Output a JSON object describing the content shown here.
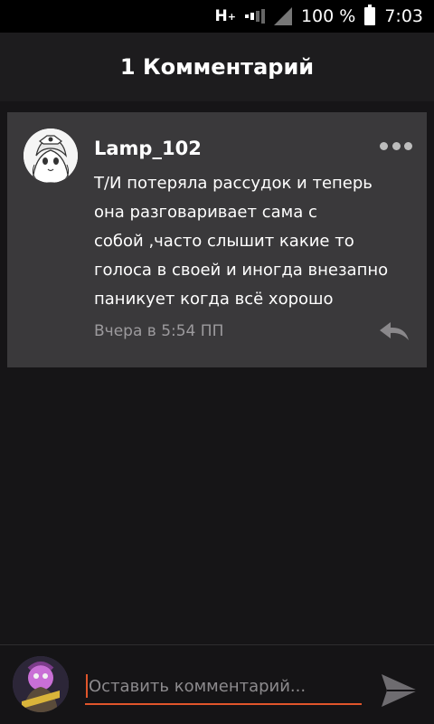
{
  "status_bar": {
    "network_type": "H",
    "network_sup": "+",
    "battery_percent": "100 %",
    "time": "7:03"
  },
  "header": {
    "title": "1 Комментарий"
  },
  "comment": {
    "username": "Lamp_102",
    "text": "Т/И потеряла рассудок и теперь\nона разговаривает сама с\nсобой ,часто  слышит какие то\nголоса в своей и иногда внезапно\nпаникует когда всё хорошо",
    "timestamp": "Вчера в 5:54 ПП",
    "icons": {
      "more": "more-dots-icon",
      "reply": "reply-arrow-icon"
    }
  },
  "composer": {
    "placeholder": "Оставить комментарий...",
    "value": "",
    "icons": {
      "send": "send-icon"
    }
  },
  "colors": {
    "background": "#161517",
    "card": "#3a393b",
    "accent": "#e0552b",
    "muted_text": "#9c9a9d"
  }
}
